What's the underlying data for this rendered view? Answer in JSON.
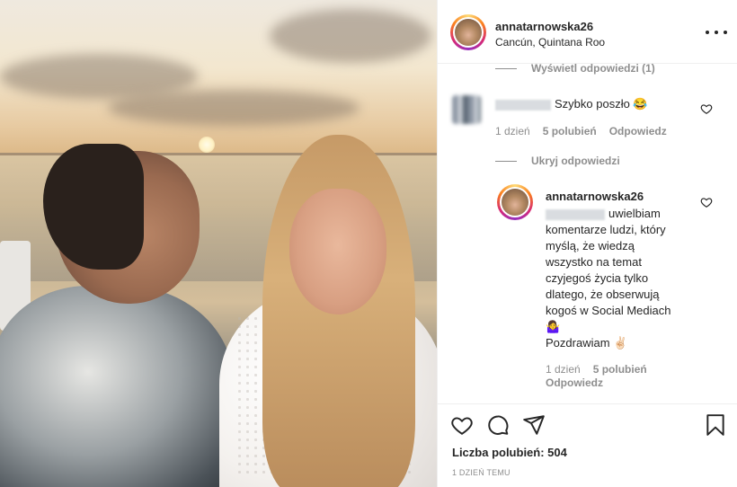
{
  "post": {
    "username": "annatarnowska26",
    "location": "Cancún, Quintana Roo",
    "photo_alt": "couple at sunset"
  },
  "comments": {
    "view_replies_label": "Wyświetl odpowiedzi (1)",
    "c1": {
      "text": "Szybko poszło 😂",
      "time": "1 dzień",
      "likes": "5 polubień",
      "reply": "Odpowiedz"
    },
    "hide_replies_label": "Ukryj odpowiedzi",
    "reply1": {
      "username": "annatarnowska26",
      "text_lines": [
        "uwielbiam",
        "komentarze ludzi, który",
        "myślą, że wiedzą",
        "wszystko na temat",
        "czyjegoś życia tylko",
        "dlatego, że obserwują",
        "kogoś w Social Mediach",
        "🤷‍♀️",
        "Pozdrawiam ✌🏻"
      ],
      "time": "1 dzień",
      "likes": "5 polubień",
      "reply": "Odpowiedz"
    }
  },
  "footer": {
    "likes_label": "Liczba polubień: 504",
    "time_ago": "1 DZIEŃ TEMU"
  },
  "icons": {
    "like": "heart-icon",
    "comment": "comment-icon",
    "share": "share-icon",
    "save": "bookmark-icon",
    "more": "more-icon"
  }
}
